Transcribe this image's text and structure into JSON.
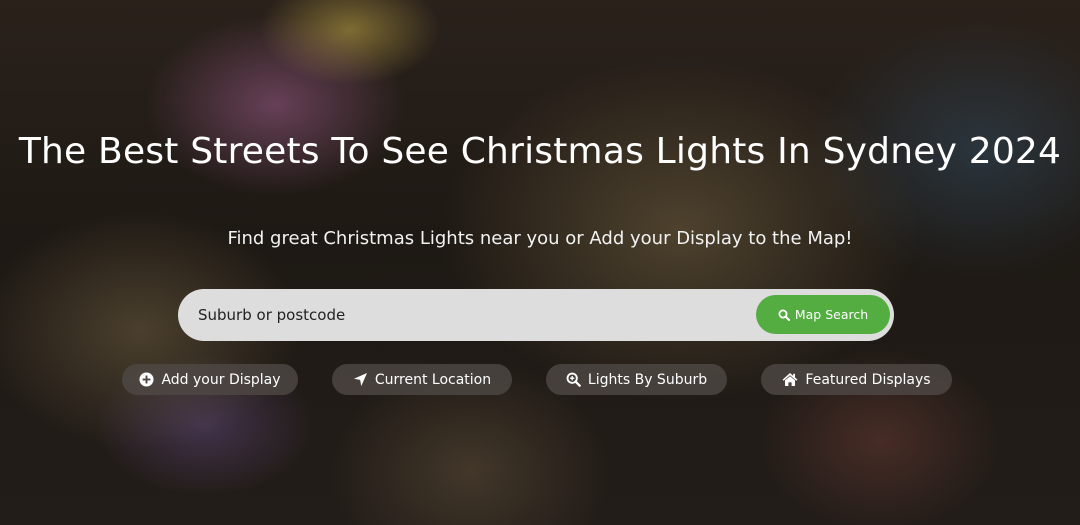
{
  "hero": {
    "title": "The Best Streets To See Christmas Lights In Sydney 2024",
    "subtitle": "Find great Christmas Lights near you or Add your Display to the Map!"
  },
  "search": {
    "placeholder": "Suburb or postcode",
    "button_label": "Map Search",
    "button_icon": "search-icon",
    "button_color": "#54ad41"
  },
  "quick_links": {
    "add_display": {
      "label": "Add your Display",
      "icon": "plus-circle-icon"
    },
    "current_location": {
      "label": "Current Location",
      "icon": "location-arrow-icon"
    },
    "lights_by_suburb": {
      "label": "Lights By Suburb",
      "icon": "search-plus-icon"
    },
    "featured_displays": {
      "label": "Featured Displays",
      "icon": "home-icon"
    }
  },
  "colors": {
    "accent": "#54ad41",
    "pill_background": "#4e4844",
    "search_bar": "#dddddd",
    "text": "#ffffff"
  }
}
